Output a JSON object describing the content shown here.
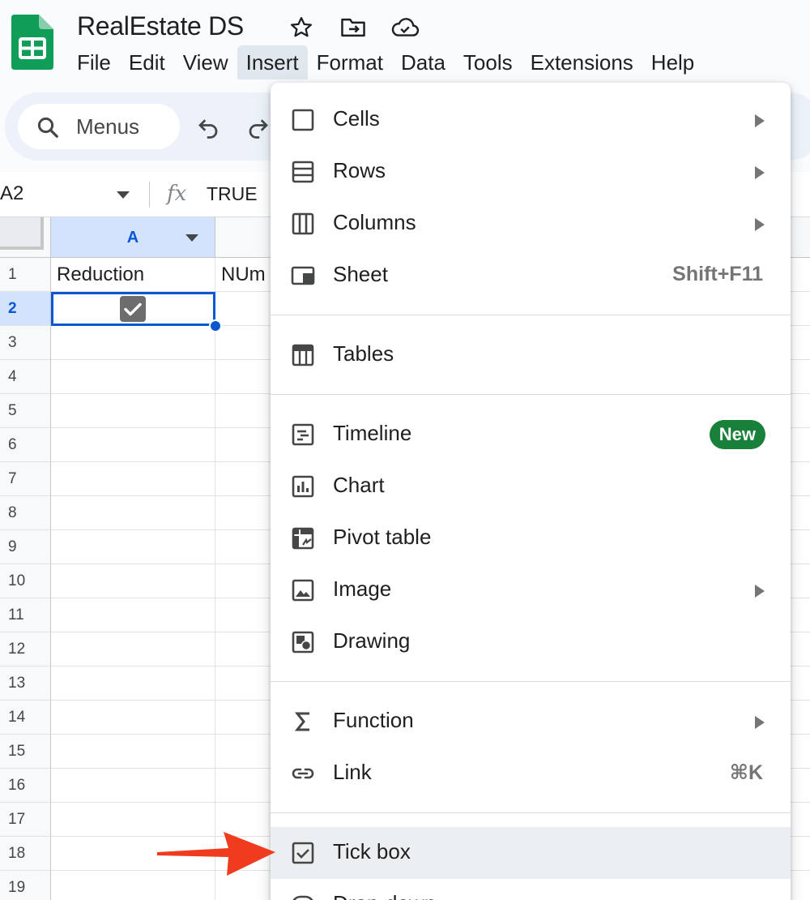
{
  "app": {
    "doc_title": "RealEstate DS",
    "brand_color": "#0f9d58",
    "menubar": [
      "File",
      "Edit",
      "View",
      "Insert",
      "Format",
      "Data",
      "Tools",
      "Extensions",
      "Help"
    ],
    "active_menu": "Insert"
  },
  "toolbar": {
    "search_label": "Menus",
    "icons": [
      "search-icon",
      "undo-icon",
      "redo-icon"
    ]
  },
  "formula_bar": {
    "cell_ref": "A2",
    "fx_label": "fx",
    "value": "TRUE"
  },
  "grid": {
    "col_a_header": "A",
    "rows": [
      "1",
      "2",
      "3",
      "4",
      "5",
      "6",
      "7",
      "8",
      "9",
      "10",
      "11",
      "12",
      "13",
      "14",
      "15",
      "16",
      "17",
      "18",
      "19"
    ],
    "selected_row": "2",
    "cells": {
      "a1": "Reduction",
      "b1": "NUm"
    },
    "a2_checked": true
  },
  "insert_menu": {
    "items": [
      {
        "label": "Cells",
        "icon": "cells-icon",
        "submenu": true
      },
      {
        "label": "Rows",
        "icon": "rows-icon",
        "submenu": true
      },
      {
        "label": "Columns",
        "icon": "columns-icon",
        "submenu": true
      },
      {
        "label": "Sheet",
        "icon": "sheet-icon",
        "shortcut": "Shift+F11"
      },
      {
        "label": "Tables",
        "icon": "tables-icon"
      },
      {
        "label": "Timeline",
        "icon": "timeline-icon",
        "badge": "New"
      },
      {
        "label": "Chart",
        "icon": "chart-icon"
      },
      {
        "label": "Pivot table",
        "icon": "pivot-table-icon"
      },
      {
        "label": "Image",
        "icon": "image-icon",
        "submenu": true
      },
      {
        "label": "Drawing",
        "icon": "drawing-icon"
      },
      {
        "label": "Function",
        "icon": "function-icon",
        "submenu": true
      },
      {
        "label": "Link",
        "icon": "link-icon",
        "shortcut": "⌘K"
      },
      {
        "label": "Tick box",
        "icon": "tick-box-icon",
        "highlighted": true
      },
      {
        "label": "Drop-down",
        "icon": "dropdown-icon"
      }
    ]
  },
  "annotation": {
    "color": "#f03c1e"
  }
}
